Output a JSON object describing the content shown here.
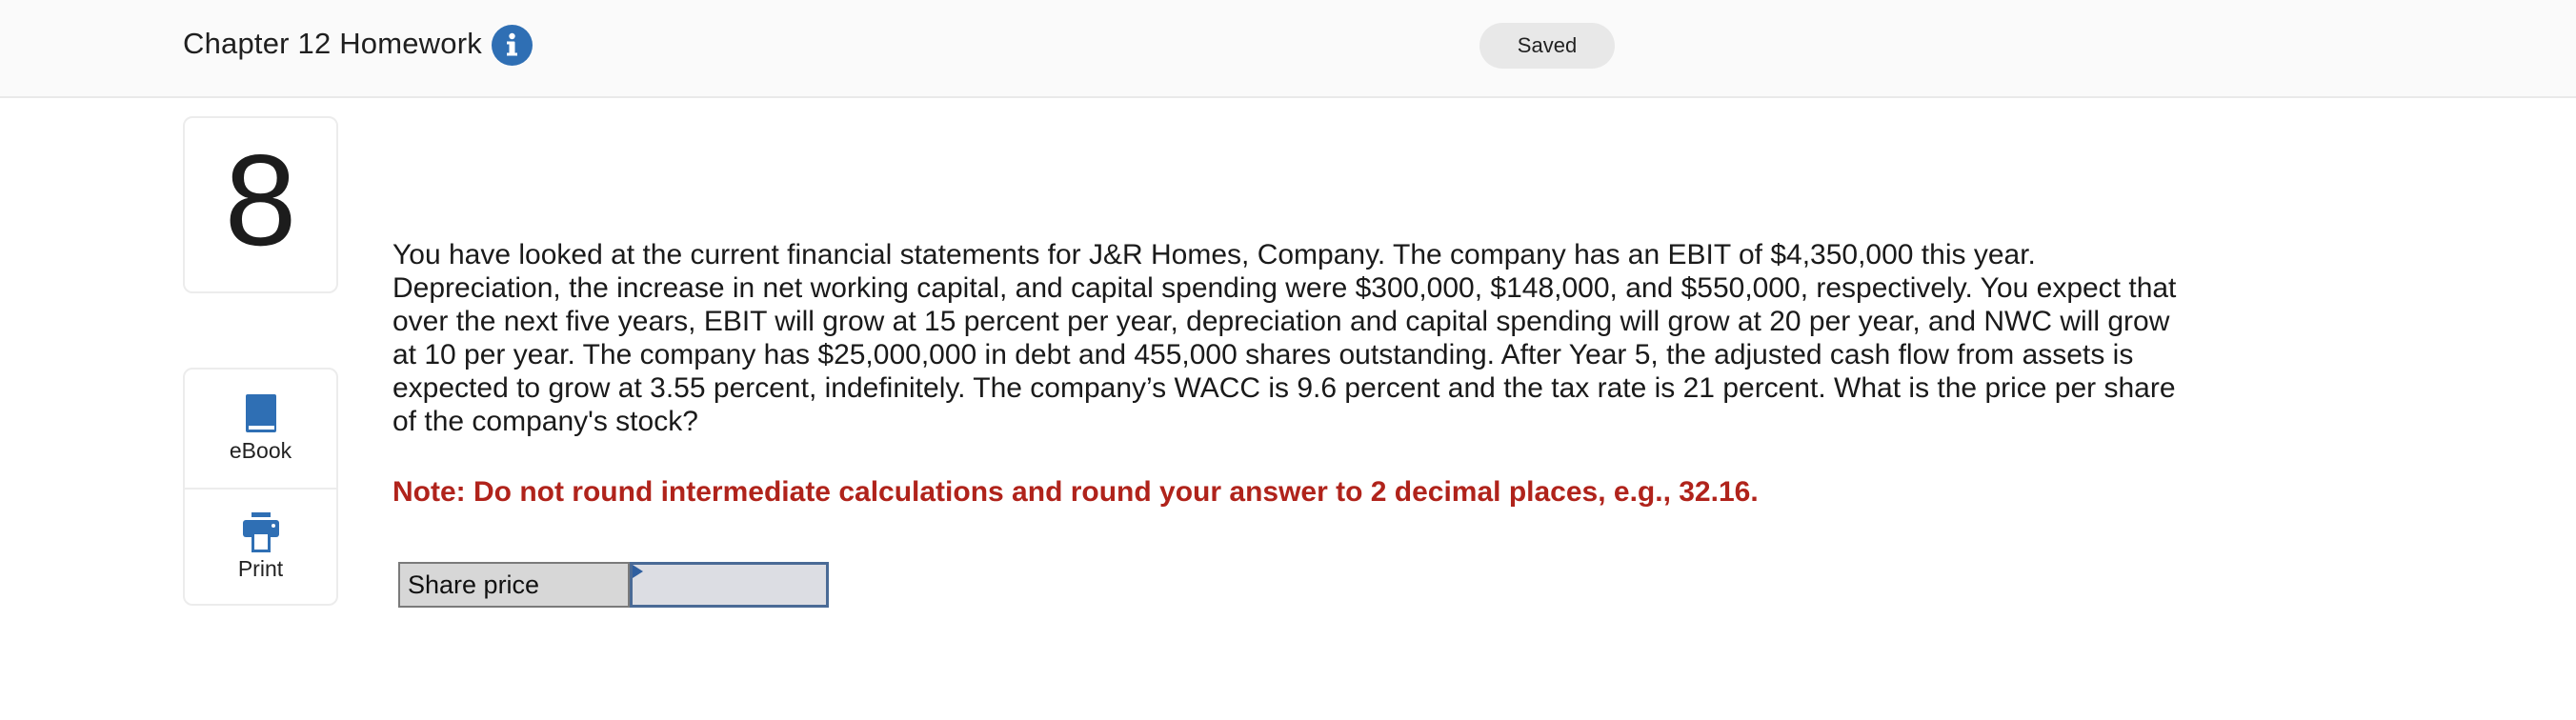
{
  "header": {
    "title": "Chapter 12 Homework",
    "info_icon": "info-circle-icon",
    "status": "Saved"
  },
  "question": {
    "number": "8",
    "text": "You have looked at the current financial statements for J&R Homes, Company. The company has an EBIT of $4,350,000 this year. Depreciation, the increase in net working capital, and capital spending were $300,000, $148,000, and $550,000, respectively. You expect that over the next five years, EBIT will grow at 15 percent per year, depreciation and capital spending will grow at 20 per year, and NWC will grow at 10 per year. The company has $25,000,000 in debt and 455,000 shares outstanding. After Year 5, the adjusted cash flow from assets is expected to grow at 3.55 percent, indefinitely. The company’s WACC is 9.6 percent and the tax rate is 21 percent. What is the price per share of the company's stock?",
    "note": "Note: Do not round intermediate calculations and round your answer to 2 decimal places, e.g., 32.16."
  },
  "tools": [
    {
      "label": "eBook",
      "icon": "book-icon"
    },
    {
      "label": "Print",
      "icon": "printer-icon"
    }
  ],
  "answer": {
    "label": "Share price",
    "value": ""
  },
  "colors": {
    "accent": "#2f6fb4",
    "note": "#b0231b",
    "input_border": "#4a6a96"
  }
}
